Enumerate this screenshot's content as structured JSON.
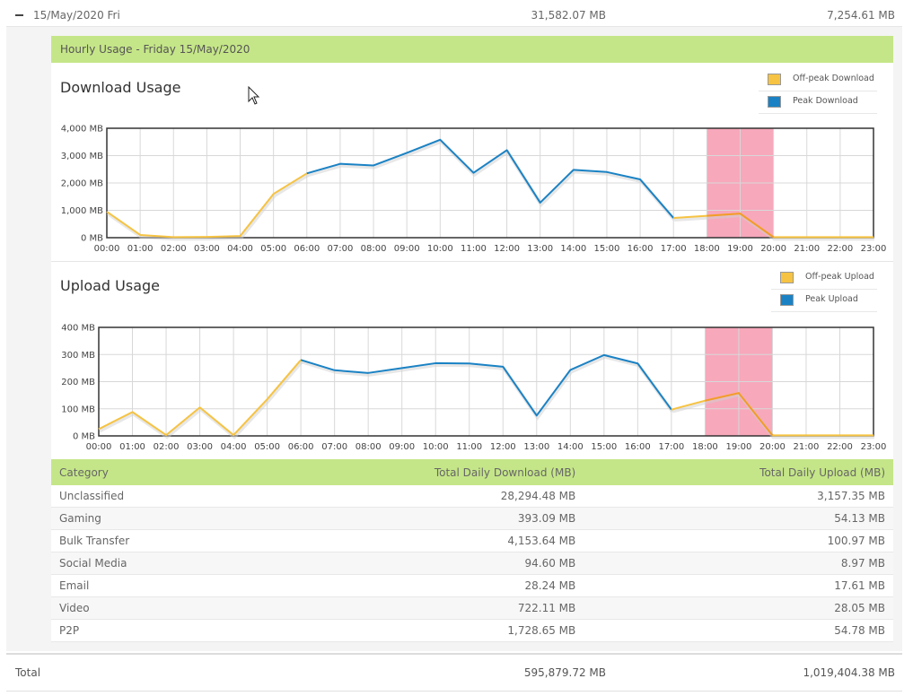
{
  "day_row": {
    "date": "15/May/2020 Fri",
    "download": "31,582.07 MB",
    "upload": "7,254.61 MB"
  },
  "hourly_header": "Hourly Usage - Friday 15/May/2020",
  "colors": {
    "offpeak": "#f6c342",
    "peak": "#1a82c4",
    "highlight": "#f7a8bb",
    "header_green": "#c5e688"
  },
  "chart_data": [
    {
      "type": "line",
      "title": "Download Usage",
      "legend": [
        "Off-peak Download",
        "Peak Download"
      ],
      "legend_position": "top-right",
      "x": [
        "00:00",
        "01:00",
        "02:00",
        "03:00",
        "04:00",
        "05:00",
        "06:00",
        "07:00",
        "08:00",
        "09:00",
        "10:00",
        "11:00",
        "12:00",
        "13:00",
        "14:00",
        "15:00",
        "16:00",
        "17:00",
        "18:00",
        "19:00",
        "20:00",
        "21:00",
        "22:00",
        "23:00"
      ],
      "y_ticks": [
        "0 MB",
        "1,000 MB",
        "2,000 MB",
        "3,000 MB",
        "4,000 MB"
      ],
      "ylim": [
        0,
        4000
      ],
      "values": [
        950,
        100,
        20,
        30,
        60,
        1600,
        2350,
        2700,
        2640,
        3100,
        3580,
        2370,
        3200,
        1280,
        2480,
        2400,
        2130,
        720,
        800,
        880,
        20,
        20,
        20,
        20
      ],
      "peak_start": 6,
      "peak_end": 17,
      "highlight_range": [
        18,
        20
      ],
      "grid": true
    },
    {
      "type": "line",
      "title": "Upload Usage",
      "legend": [
        "Off-peak Upload",
        "Peak Upload"
      ],
      "legend_position": "top-right",
      "x": [
        "00:00",
        "01:00",
        "02:00",
        "03:00",
        "04:00",
        "05:00",
        "06:00",
        "07:00",
        "08:00",
        "09:00",
        "10:00",
        "11:00",
        "12:00",
        "13:00",
        "14:00",
        "15:00",
        "16:00",
        "17:00",
        "18:00",
        "19:00",
        "20:00",
        "21:00",
        "22:00",
        "23:00"
      ],
      "y_ticks": [
        "0 MB",
        "100 MB",
        "200 MB",
        "300 MB",
        "400 MB"
      ],
      "ylim": [
        0,
        400
      ],
      "values": [
        25,
        88,
        3,
        105,
        3,
        135,
        280,
        242,
        232,
        250,
        268,
        267,
        255,
        75,
        243,
        298,
        267,
        97,
        130,
        158,
        2,
        2,
        2,
        2
      ],
      "peak_start": 6,
      "peak_end": 17,
      "highlight_range": [
        18,
        20
      ],
      "grid": true
    }
  ],
  "table": {
    "headers": [
      "Category",
      "Total Daily Download (MB)",
      "Total Daily Upload (MB)"
    ],
    "rows": [
      [
        "Unclassified",
        "28,294.48 MB",
        "3,157.35 MB"
      ],
      [
        "Gaming",
        "393.09 MB",
        "54.13 MB"
      ],
      [
        "Bulk Transfer",
        "4,153.64 MB",
        "100.97 MB"
      ],
      [
        "Social Media",
        "94.60 MB",
        "8.97 MB"
      ],
      [
        "Email",
        "28.24 MB",
        "17.61 MB"
      ],
      [
        "Video",
        "722.11 MB",
        "28.05 MB"
      ],
      [
        "P2P",
        "1,728.65 MB",
        "54.78 MB"
      ]
    ]
  },
  "total": {
    "label": "Total",
    "download": "595,879.72 MB",
    "upload": "1,019,404.38 MB"
  }
}
